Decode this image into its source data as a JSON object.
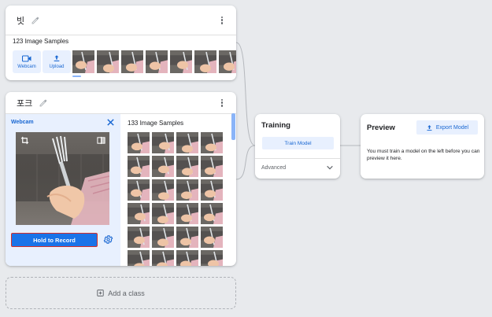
{
  "classes": [
    {
      "name": "빗",
      "samples_label": "123 Image Samples",
      "buttons": {
        "webcam": "Webcam",
        "upload": "Upload"
      },
      "visible_thumbnails": 7
    },
    {
      "name": "포크",
      "samples_label": "133 Image Samples",
      "webcam_panel": {
        "title": "Webcam",
        "record_label": "Hold to Record"
      },
      "visible_thumbnails": 24
    }
  ],
  "add_class": {
    "label": "Add a class"
  },
  "training": {
    "title": "Training",
    "train_button": "Train Model",
    "advanced_label": "Advanced"
  },
  "preview": {
    "title": "Preview",
    "export_button": "Export Model",
    "message": "You must train a model on the left before you can preview it here."
  },
  "colors": {
    "accent": "#1a73e8",
    "accent_text": "#1967d2",
    "accent_light": "#e8f0fe",
    "record_border": "#d93025",
    "canvas": "#e8eaed"
  },
  "icons": {
    "edit": "pencil-icon",
    "more": "more-vert-icon",
    "webcam": "videocam-icon",
    "upload": "upload-icon",
    "close": "close-icon",
    "crop": "crop-icon",
    "flip": "flip-icon",
    "settings": "gear-icon",
    "add": "add-box-icon",
    "expand": "chevron-down-icon",
    "export": "upload-icon"
  }
}
